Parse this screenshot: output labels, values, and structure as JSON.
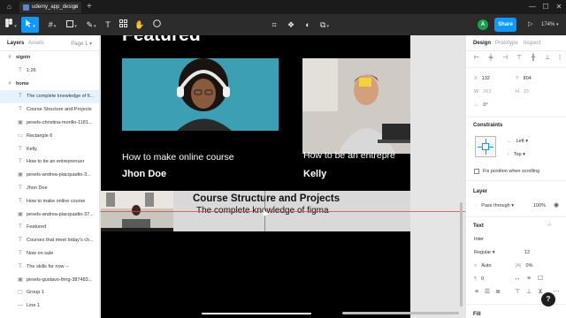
{
  "window": {
    "tab_title": "udemy_app_design",
    "controls": [
      "minimize-icon",
      "maximize-icon",
      "close-icon"
    ]
  },
  "toolbar": {
    "tools": [
      "move-tool",
      "frame-tool",
      "shape-tool",
      "pen-tool",
      "text-tool",
      "hand-tool",
      "comment-tool"
    ],
    "active_tool": "move-tool",
    "center_tools": [
      "crop-icon",
      "component-icon",
      "mask-icon",
      "boolean-icon"
    ],
    "avatar_initial": "A",
    "share_label": "Share",
    "zoom_label": "174%",
    "accent": "#0d99ff"
  },
  "left_panel": {
    "tabs": [
      "Layers",
      "Assets"
    ],
    "active_tab": "Layers",
    "page_label": "Page 1",
    "layers": [
      {
        "icon": "frame-icon",
        "label": "signin",
        "depth": 0,
        "frame": true
      },
      {
        "icon": "text-icon",
        "label": "1:26",
        "depth": 1
      },
      {
        "icon": "frame-icon",
        "label": "home",
        "depth": 0,
        "frame": true
      },
      {
        "icon": "text-icon",
        "label": "The complete knowledge of fi...",
        "depth": 1,
        "selected": true
      },
      {
        "icon": "text-icon",
        "label": "Course Structure and Projects",
        "depth": 1
      },
      {
        "icon": "image-icon",
        "label": "pexels-christina-morillo-1181...",
        "depth": 1
      },
      {
        "icon": "rectangle-icon",
        "label": "Rectangle 6",
        "depth": 1
      },
      {
        "icon": "text-icon",
        "label": "Kelly",
        "depth": 1
      },
      {
        "icon": "text-icon",
        "label": "How to be an entreprenuer",
        "depth": 1
      },
      {
        "icon": "image-icon",
        "label": "pexels-andrea-piacquadio-3...",
        "depth": 1
      },
      {
        "icon": "text-icon",
        "label": "Jhon Doe",
        "depth": 1
      },
      {
        "icon": "text-icon",
        "label": "How to make online course",
        "depth": 1
      },
      {
        "icon": "image-icon",
        "label": "pexels-andrea-piacquadio-37...",
        "depth": 1
      },
      {
        "icon": "text-icon",
        "label": "Featured",
        "depth": 1
      },
      {
        "icon": "text-icon",
        "label": "Courses that meet today's ch...",
        "depth": 1
      },
      {
        "icon": "text-icon",
        "label": "Now on sale",
        "depth": 1
      },
      {
        "icon": "text-icon",
        "label": "The skills for now --",
        "depth": 1
      },
      {
        "icon": "image-icon",
        "label": "pexels-gustavo-fring-387483...",
        "depth": 1
      },
      {
        "icon": "group-icon",
        "label": "Group 1",
        "depth": 1
      },
      {
        "icon": "line-icon",
        "label": "Line 1",
        "depth": 1
      }
    ]
  },
  "canvas": {
    "heading": "Featured",
    "cards": [
      {
        "title": "How to make online course",
        "author": "Jhon Doe"
      },
      {
        "title": "How to be an entrepre",
        "author": "Kelly"
      }
    ],
    "course": {
      "title": "Course Structure and Projects",
      "subtitle": "The complete knowledge of figma"
    }
  },
  "right_panel": {
    "tabs": [
      "Design",
      "Prototype",
      "Inspect"
    ],
    "active_tab": "Design",
    "position": {
      "x_label": "X",
      "x_value": "132",
      "y_label": "Y",
      "y_value": "804"
    },
    "size": {
      "w_label": "W",
      "w_value": "263",
      "h_label": "H",
      "h_value": "15"
    },
    "rotation": "0°",
    "constraints_title": "Constraints",
    "constraint_h": "Left",
    "constraint_v": "Top",
    "fix_position_label": "Fix position when scrolling",
    "layer_title": "Layer",
    "blend_mode": "Pass through",
    "opacity": "100%",
    "text_title": "Text",
    "font_family": "Inter",
    "font_weight": "Regular",
    "font_size": "12",
    "line_height": "Auto",
    "letter_spacing": "0%",
    "paragraph_spacing": "0",
    "fill_title": "Fill"
  }
}
